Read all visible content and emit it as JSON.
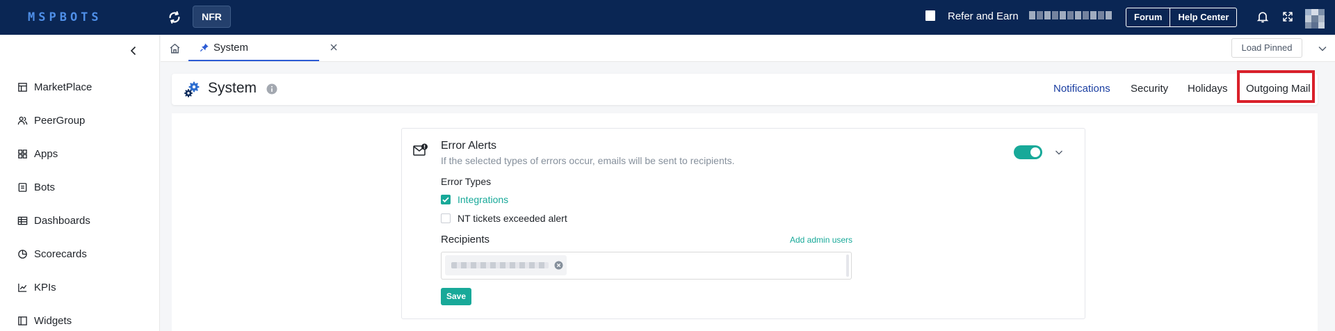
{
  "topbar": {
    "logo": "MSPBOTS",
    "nfr_label": "NFR",
    "refer_label": "Refer and Earn",
    "forum_label": "Forum",
    "help_center_label": "Help Center"
  },
  "sidebar": {
    "items": [
      {
        "label": "MarketPlace",
        "icon": "marketplace-icon"
      },
      {
        "label": "PeerGroup",
        "icon": "peergroup-icon"
      },
      {
        "label": "Apps",
        "icon": "apps-icon"
      },
      {
        "label": "Bots",
        "icon": "bots-icon"
      },
      {
        "label": "Dashboards",
        "icon": "dashboards-icon"
      },
      {
        "label": "Scorecards",
        "icon": "scorecards-icon"
      },
      {
        "label": "KPIs",
        "icon": "kpis-icon"
      },
      {
        "label": "Widgets",
        "icon": "widgets-icon"
      }
    ]
  },
  "tabs": {
    "open_tab_label": "System",
    "load_pinned_label": "Load Pinned"
  },
  "page": {
    "title": "System",
    "tabs": [
      "Notifications",
      "Security",
      "Holidays",
      "Outgoing Mail"
    ],
    "active_tab": "Notifications"
  },
  "error_alerts": {
    "title": "Error Alerts",
    "description": "If the selected types of errors occur, emails will be sent to recipients.",
    "enabled": true,
    "error_types_label": "Error Types",
    "error_types": [
      {
        "label": "Integrations",
        "checked": true
      },
      {
        "label": "NT tickets exceeded alert",
        "checked": false
      }
    ],
    "recipients_label": "Recipients",
    "add_admin_label": "Add admin users",
    "save_label": "Save"
  },
  "colors": {
    "topbar": "#0a2654",
    "accent": "#18a999",
    "active_tab": "#1a3ea1",
    "highlight": "#d9202a"
  }
}
